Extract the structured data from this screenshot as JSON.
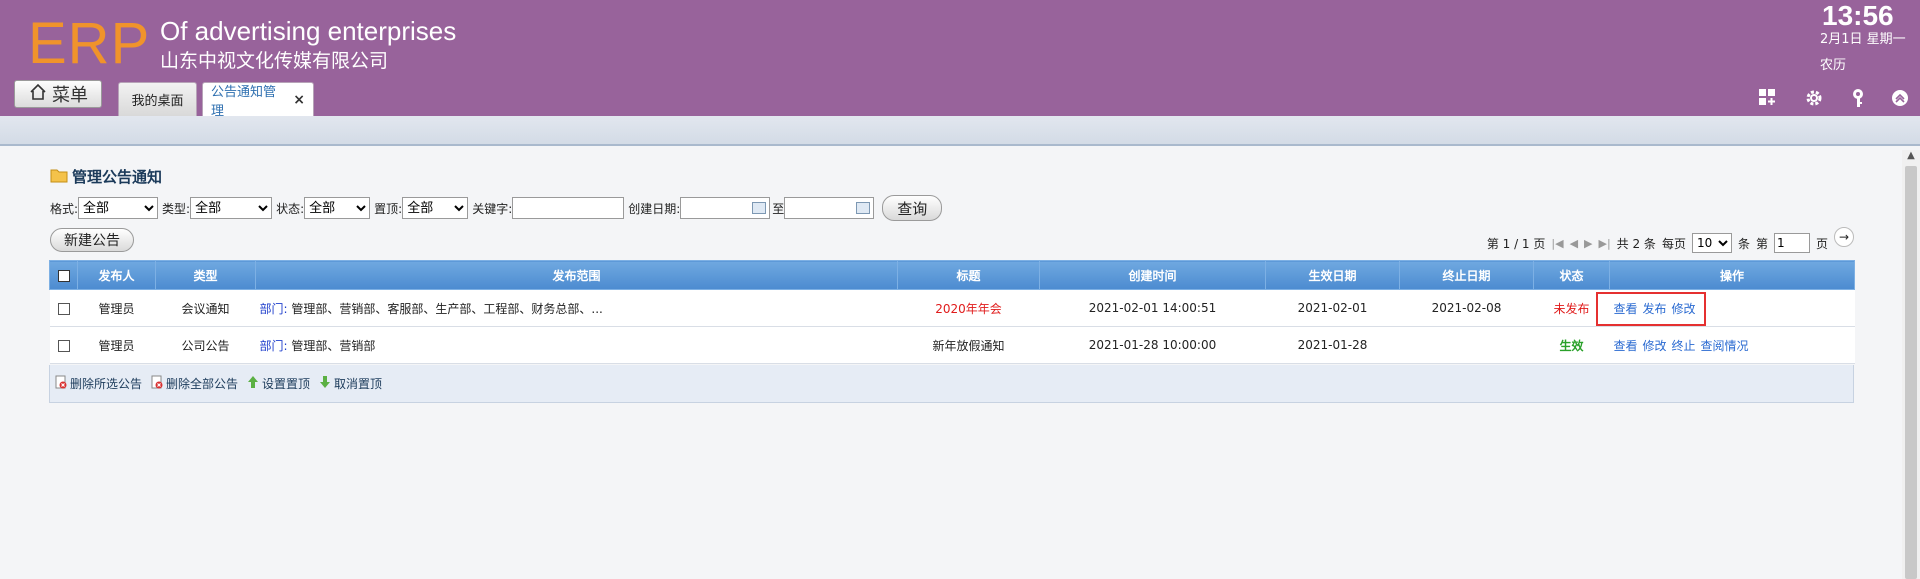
{
  "header": {
    "logo": "ERP",
    "tagline": "Of advertising enterprises",
    "company": "山东中视文化传媒有限公司",
    "time": "13:56",
    "date": "2月1日 星期一",
    "lunar": "农历"
  },
  "nav": {
    "menu_label": "菜单",
    "tabs": [
      {
        "label": "我的桌面"
      },
      {
        "label": "公告通知管理",
        "close": "×"
      }
    ]
  },
  "page": {
    "title": "管理公告通知"
  },
  "filters": {
    "format_label": "格式:",
    "format_value": "全部",
    "type_label": "类型:",
    "type_value": "全部",
    "status_label": "状态:",
    "status_value": "全部",
    "pin_label": "置顶:",
    "pin_value": "全部",
    "keyword_label": "关键字:",
    "keyword_value": "",
    "created_label": "创建日期:",
    "created_from": "",
    "to_label": "至",
    "created_to": "",
    "query_label": "查询"
  },
  "actions": {
    "new_label": "新建公告"
  },
  "pager": {
    "page_text": "第 1 / 1 页",
    "first": "|◀",
    "prev": "◀",
    "next": "▶",
    "last": "▶|",
    "total_text": "共 2 条",
    "per_page_label": "每页",
    "per_page_value": "10",
    "per_page_unit": "条",
    "goto_label": "第",
    "goto_value": "1",
    "goto_unit": "页",
    "go_icon": "→"
  },
  "table": {
    "columns": [
      "发布人",
      "类型",
      "发布范围",
      "标题",
      "创建时间",
      "生效日期",
      "终止日期",
      "状态",
      "操作"
    ],
    "rows": [
      {
        "publisher": "管理员",
        "type": "会议通知",
        "scope_prefix": "部门:",
        "scope": "管理部、营销部、客服部、生产部、工程部、财务总部、...",
        "title": "2020年年会",
        "created": "2021-02-01 14:00:51",
        "effective": "2021-02-01",
        "end": "2021-02-08",
        "status": "未发布",
        "ops": [
          "查看",
          "发布",
          "修改"
        ]
      },
      {
        "publisher": "管理员",
        "type": "公司公告",
        "scope_prefix": "部门:",
        "scope": "管理部、营销部",
        "title": "新年放假通知",
        "created": "2021-01-28 10:00:00",
        "effective": "2021-01-28",
        "end": "",
        "status": "生效",
        "ops": [
          "查看",
          "修改",
          "终止",
          "查阅情况"
        ]
      }
    ]
  },
  "footer": {
    "delete_selected": "删除所选公告",
    "delete_all": "删除全部公告",
    "set_top": "设置置顶",
    "cancel_top": "取消置顶"
  },
  "colors": {
    "header_bg": "#98639b",
    "logo": "#f0932b",
    "table_header": "#5a97d8",
    "link": "#2a6ad1",
    "unpublished": "#e01b1b",
    "active": "#2aa12a"
  }
}
